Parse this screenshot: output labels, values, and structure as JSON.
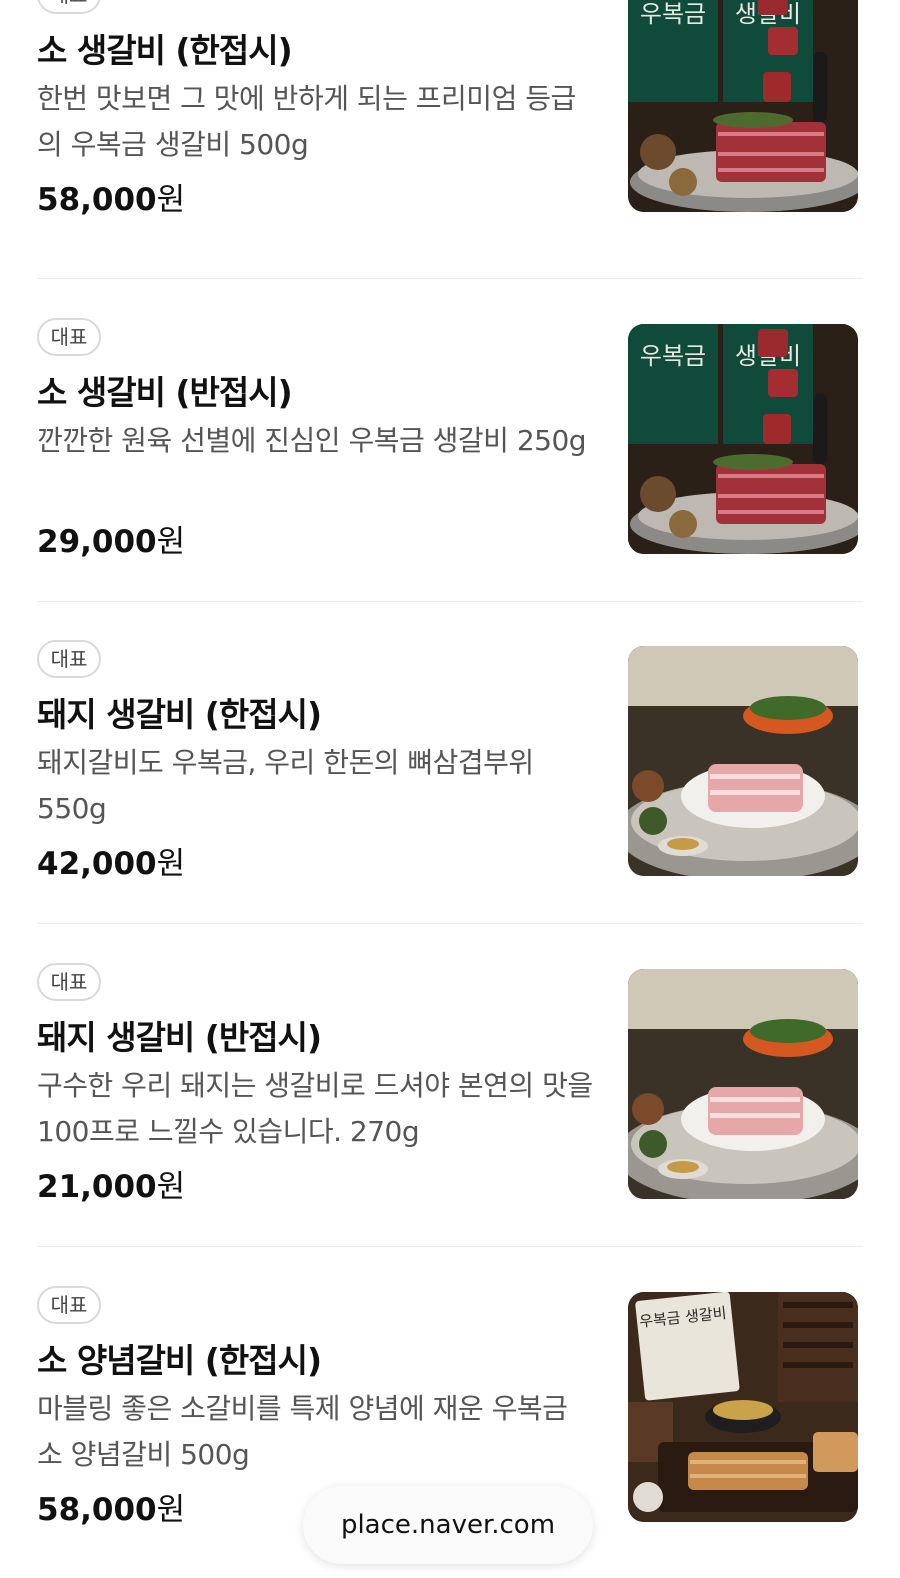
{
  "items": [
    {
      "badge": "대표",
      "name": "소 생갈비 (한접시)",
      "desc": "한번 맛보면 그 맛에 반하게 되는 프리미엄 등급의 우복금 생갈비 500g",
      "price": "58,000",
      "currency": "원",
      "image_icon": "beef-ribs-photo",
      "sign_left": "우복금",
      "sign_right": "생갈비"
    },
    {
      "badge": "대표",
      "name": "소 생갈비 (반접시)",
      "desc": "깐깐한 원육 선별에 진심인 우복금 생갈비 250g",
      "price": "29,000",
      "currency": "원",
      "image_icon": "beef-ribs-photo",
      "sign_left": "우복금",
      "sign_right": "생갈비"
    },
    {
      "badge": "대표",
      "name": "돼지 생갈비 (한접시)",
      "desc": "돼지갈비도 우복금, 우리 한돈의 뼈삼겹부위 550g",
      "price": "42,000",
      "currency": "원",
      "image_icon": "pork-ribs-photo"
    },
    {
      "badge": "대표",
      "name": "돼지 생갈비 (반접시)",
      "desc": "구수한 우리 돼지는 생갈비로 드셔야 본연의 맛을 100프로 느낄수 있습니다. 270g",
      "price": "21,000",
      "currency": "원",
      "image_icon": "pork-ribs-photo"
    },
    {
      "badge": "대표",
      "name": "소 양념갈비 (한접시)",
      "desc": "마블링 좋은 소갈비를 특제 양념에 재운 우복금 소 양념갈비 500g",
      "price": "58,000",
      "currency": "원",
      "image_icon": "marinated-beef-ribs-photo",
      "sign_text": "우복금 생갈비"
    }
  ],
  "browser": {
    "url": "place.naver.com"
  }
}
